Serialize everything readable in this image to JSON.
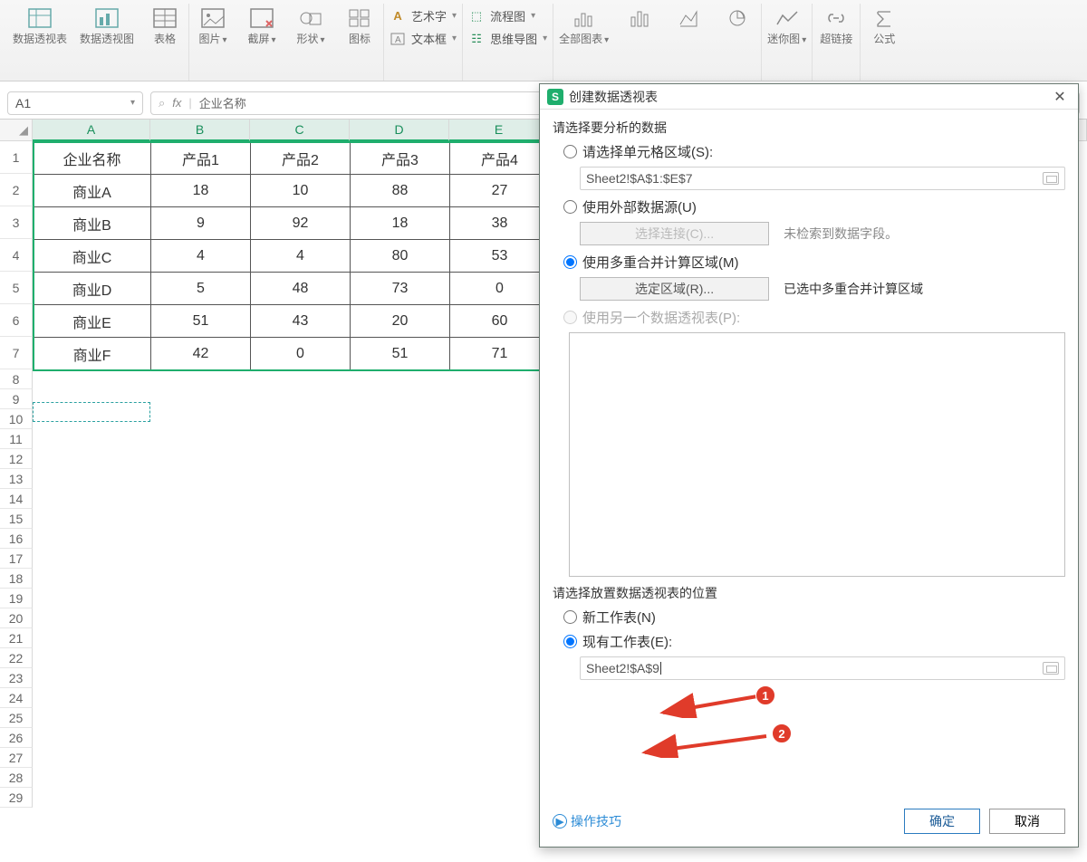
{
  "ribbon": {
    "g1": {
      "pivot_table": "数据透视表",
      "pivot_chart": "数据透视图",
      "table": "表格"
    },
    "g2": {
      "picture": "图片",
      "screenshot": "截屏",
      "shapes": "形状",
      "icons": "图标"
    },
    "g3": {
      "wordart": "艺术字",
      "flow": "流程图",
      "textbox": "文本框",
      "mindmap": "思维导图"
    },
    "g4": {
      "allcharts": "全部图表"
    },
    "g5": {
      "sparkline": "迷你图"
    },
    "g6": {
      "hyperlink": "超链接"
    },
    "g7": {
      "formula": "公式"
    }
  },
  "formula_bar": {
    "cell": "A1",
    "fx": "fx",
    "value": "企业名称"
  },
  "sheet": {
    "columns": [
      "A",
      "B",
      "C",
      "D",
      "E"
    ],
    "row_numbers": [
      1,
      2,
      3,
      4,
      5,
      6,
      7,
      8,
      9,
      10,
      11,
      12,
      13,
      14,
      15,
      16,
      17,
      18,
      19,
      20,
      21,
      22,
      23,
      24,
      25,
      26,
      27,
      28,
      29
    ],
    "headers": [
      "企业名称",
      "产品1",
      "产品2",
      "产品3",
      "产品4"
    ],
    "rows": [
      [
        "商业A",
        "18",
        "10",
        "88",
        "27"
      ],
      [
        "商业B",
        "9",
        "92",
        "18",
        "38"
      ],
      [
        "商业C",
        "4",
        "4",
        "80",
        "53"
      ],
      [
        "商业D",
        "5",
        "48",
        "73",
        "0"
      ],
      [
        "商业E",
        "51",
        "43",
        "20",
        "60"
      ],
      [
        "商业F",
        "42",
        "0",
        "51",
        "71"
      ]
    ]
  },
  "dialog": {
    "title": "创建数据透视表",
    "sec1": "请选择要分析的数据",
    "opt_range": "请选择单元格区域(S):",
    "range_value": "Sheet2!$A$1:$E$7",
    "opt_external": "使用外部数据源(U)",
    "btn_conn": "选择连接(C)...",
    "conn_hint": "未检索到数据字段。",
    "opt_multi": "使用多重合并计算区域(M)",
    "btn_area": "选定区域(R)...",
    "area_hint": "已选中多重合并计算区域",
    "opt_another": "使用另一个数据透视表(P):",
    "sec2": "请选择放置数据透视表的位置",
    "opt_new": "新工作表(N)",
    "opt_exist": "现有工作表(E):",
    "exist_value": "Sheet2!$A$9",
    "tips": "操作技巧",
    "ok": "确定",
    "cancel": "取消"
  },
  "anno": {
    "b1": "1",
    "b2": "2"
  }
}
